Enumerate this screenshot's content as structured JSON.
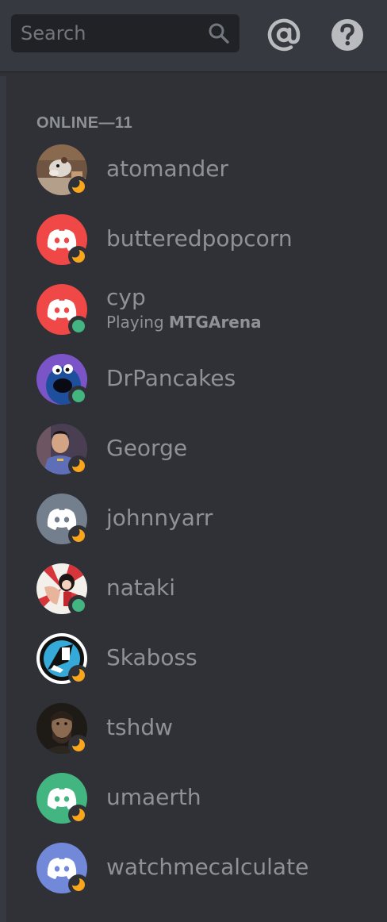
{
  "search": {
    "placeholder": "Search"
  },
  "header_icons": {
    "mention": "at-sign-icon",
    "help": "help-icon"
  },
  "section": {
    "label": "ONLINE—11"
  },
  "colors": {
    "background": "#2f3136",
    "topbar": "#36393f",
    "idle": "#faa61a",
    "online": "#43b581",
    "red_avatar": "#f04747",
    "grey_avatar": "#747f8d",
    "green_avatar": "#43b581",
    "blurple_avatar": "#7289da"
  },
  "members": [
    {
      "name": "atomander",
      "status": "idle",
      "avatar": "photo-opossum"
    },
    {
      "name": "butteredpopcorn",
      "status": "idle",
      "avatar": "default-red"
    },
    {
      "name": "cyp",
      "status": "online",
      "avatar": "default-red",
      "activity_prefix": "Playing",
      "activity_game": "MTGArena"
    },
    {
      "name": "DrPancakes",
      "status": "online",
      "avatar": "photo-cookie-monster"
    },
    {
      "name": "George",
      "status": "idle",
      "avatar": "photo-spock"
    },
    {
      "name": "johnnyarr",
      "status": "idle",
      "avatar": "default-grey"
    },
    {
      "name": "nataki",
      "status": "online",
      "avatar": "photo-anime"
    },
    {
      "name": "Skaboss",
      "status": "idle",
      "avatar": "photo-logo"
    },
    {
      "name": "tshdw",
      "status": "idle",
      "avatar": "photo-man"
    },
    {
      "name": "umaerth",
      "status": "idle",
      "avatar": "default-green"
    },
    {
      "name": "watchmecalculate",
      "status": "idle",
      "avatar": "default-blurple"
    }
  ]
}
